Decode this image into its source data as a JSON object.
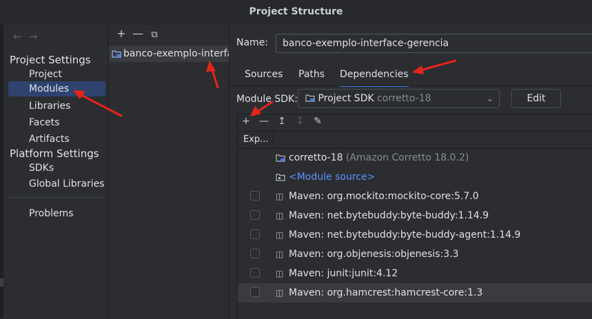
{
  "window": {
    "title": "Project Structure"
  },
  "nav": {
    "back_arrow": "←",
    "forward_arrow": "→",
    "project_settings": "Project Settings",
    "platform_settings": "Platform Settings",
    "items": {
      "project": "Project",
      "modules": "Modules",
      "libraries": "Libraries",
      "facets": "Facets",
      "artifacts": "Artifacts",
      "sdks": "SDKs",
      "global_libraries": "Global Libraries",
      "problems": "Problems"
    },
    "selected": "Modules"
  },
  "modules_panel": {
    "toolbar": {
      "add": "+",
      "remove": "—",
      "copy": "⧉"
    },
    "module_name": "banco-exemplo-interface-gerencia"
  },
  "detail": {
    "name_label": "Name:",
    "name_value": "banco-exemplo-interface-gerencia",
    "tabs": [
      "Sources",
      "Paths",
      "Dependencies"
    ],
    "active_tab": "Dependencies",
    "sdk_label": "Module SDK:",
    "sdk_value": "Project SDK",
    "sdk_detail": "corretto-18",
    "edit_button": "Edit",
    "dep_toolbar": {
      "add": "+",
      "remove": "—",
      "up": "↥",
      "down": "↧",
      "edit": "✎"
    },
    "column_export": "Exp...",
    "dependencies": [
      {
        "name": "corretto-18",
        "detail": "(Amazon Corretto 18.0.2)",
        "checkbox": false,
        "kind": "sdk"
      },
      {
        "name": "<Module source>",
        "detail": "",
        "checkbox": false,
        "kind": "source"
      },
      {
        "name": "Maven: org.mockito:mockito-core:5.7.0",
        "detail": "",
        "checkbox": true,
        "kind": "library"
      },
      {
        "name": "Maven: net.bytebuddy:byte-buddy:1.14.9",
        "detail": "",
        "checkbox": true,
        "kind": "library"
      },
      {
        "name": "Maven: net.bytebuddy:byte-buddy-agent:1.14.9",
        "detail": "",
        "checkbox": true,
        "kind": "library"
      },
      {
        "name": "Maven: org.objenesis:objenesis:3.3",
        "detail": "",
        "checkbox": true,
        "kind": "library"
      },
      {
        "name": "Maven: junit:junit:4.12",
        "detail": "",
        "checkbox": true,
        "kind": "library"
      },
      {
        "name": "Maven: org.hamcrest:hamcrest-core:1.3",
        "detail": "",
        "checkbox": true,
        "kind": "library"
      }
    ]
  },
  "colors": {
    "accent": "#3d7df5",
    "selection": "#2e436e",
    "annotation": "#e8231b",
    "link": "#5c92ff"
  }
}
